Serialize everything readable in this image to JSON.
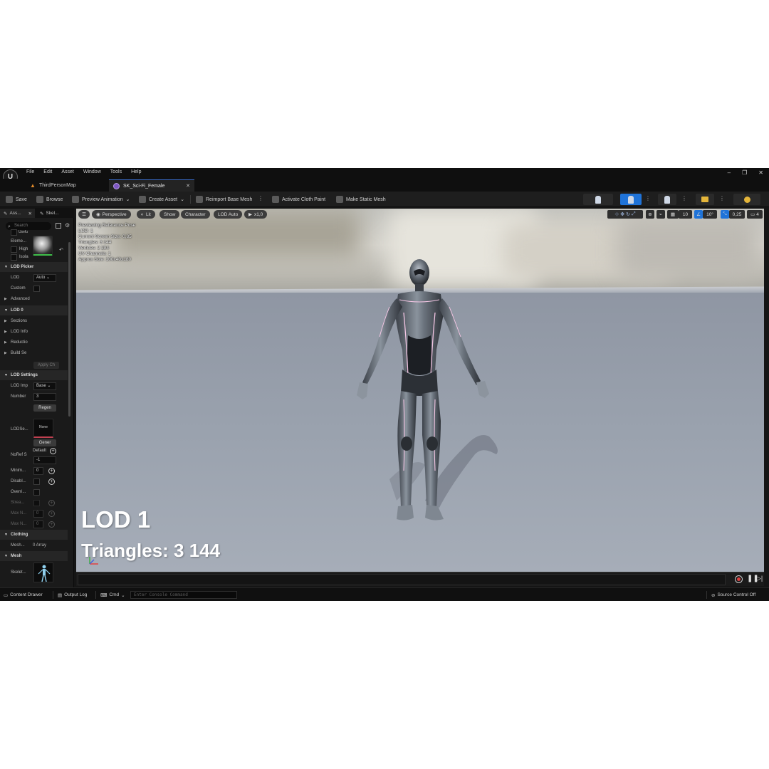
{
  "menu": {
    "items": [
      "File",
      "Edit",
      "Asset",
      "Window",
      "Tools",
      "Help"
    ]
  },
  "tabs": [
    {
      "label": "ThirdPersonMap",
      "active": false
    },
    {
      "label": "SK_Sci-Fi_Female",
      "active": true
    }
  ],
  "toolbar": {
    "save": "Save",
    "browse": "Browse",
    "preview_animation": "Preview Animation",
    "create_asset": "Create Asset",
    "reimport": "Reimport Base Mesh",
    "activate_cloth": "Activate Cloth Paint",
    "make_static": "Make Static Mesh"
  },
  "left_panel": {
    "tab1": "Ass...",
    "tab2": "Skel...",
    "search_placeholder": "Search",
    "rows": {
      "useful": "Usefu",
      "elements": "Eleme...",
      "high": "High",
      "isolate": "Isola",
      "lod_picker": "LOD Picker",
      "lod": "LOD",
      "lod_value": "Auto",
      "custom": "Custom",
      "advanced": "Advanced",
      "lod0": "LOD 0",
      "sections": "Sections",
      "lod_info": "LOD Info",
      "reduction": "Reductio",
      "build_settings": "Build Se",
      "apply_changes": "Apply Ch",
      "lod_settings": "LOD Settings",
      "lod_import": "LOD Imp",
      "lod_import_value": "Base",
      "number": "Number",
      "number_value": "3",
      "regen": "Regen",
      "lod_setting": "LODSe...",
      "none": "None",
      "generate": "Gener",
      "noref": "NoRef S",
      "default": "Default",
      "noref_value": "-1",
      "minimum": "Minim...",
      "minimum_value": "0",
      "disable": "Disabl...",
      "override": "Overri...",
      "stream": "Strea...",
      "max_n1": "Max N...",
      "max_n1_value": "0",
      "max_n2": "Max N...",
      "max_n2_value": "0",
      "clothing": "Clothing",
      "mesh_label": "Mesh...",
      "mesh_value": "0 Array",
      "mesh_section": "Mesh",
      "skeleton": "Skelet..."
    }
  },
  "viewport": {
    "perspective": "Perspective",
    "lit": "Lit",
    "show": "Show",
    "character": "Character",
    "lod_auto": "LOD Auto",
    "play_rate": "x1,0",
    "grid_snap": "10",
    "rot_snap": "10°",
    "scale_snap": "0,25",
    "cam_speed": "4",
    "info_lines": [
      "Previewing Reference Pose",
      "LOD: 1",
      "Current Screen Size: 0,85",
      "Triangles: 3 144",
      "Vertices: 2 284",
      "UV Channels: 1",
      "Approx Size: 100x40x180"
    ],
    "overlay_lod": "LOD 1",
    "overlay_triangles": "Triangles: 3 144"
  },
  "statusbar": {
    "content_drawer": "Content Drawer",
    "output_log": "Output Log",
    "cmd": "Cmd",
    "console_placeholder": "Enter Console Command",
    "source_control": "Source Control Off"
  },
  "colors": {
    "accent": "#1f73d8",
    "background": "#151515"
  }
}
